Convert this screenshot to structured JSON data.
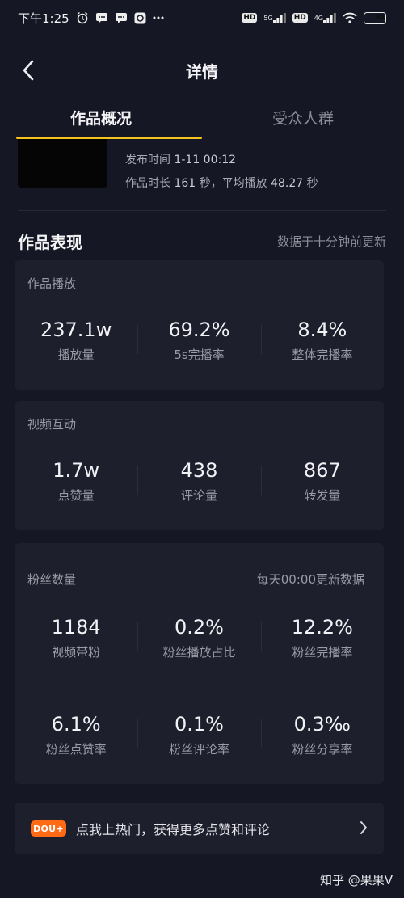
{
  "status_bar": {
    "time": "下午1:25",
    "left_icons": [
      "alarm-icon",
      "message-icon",
      "message-icon",
      "app-icon",
      "more-icon"
    ],
    "hd1": "HD",
    "net1": "5G",
    "hd2": "HD",
    "net2": "4G",
    "battery": "84"
  },
  "header": {
    "title": "详情"
  },
  "tabs": [
    {
      "label": "作品概况",
      "active": true
    },
    {
      "label": "受众人群",
      "active": false
    }
  ],
  "video": {
    "publish_label": "发布时间",
    "publish_time": "1-11 00:12",
    "duration_prefix": "作品时长",
    "duration_value": "161",
    "duration_unit": "秒，平均播放",
    "avg_value": "48.27",
    "avg_unit": "秒"
  },
  "performance": {
    "title": "作品表现",
    "note": "数据于十分钟前更新"
  },
  "playback": {
    "label": "作品播放",
    "metrics": [
      {
        "value": "237.1w",
        "label": "播放量"
      },
      {
        "value": "69.2%",
        "label": "5s完播率"
      },
      {
        "value": "8.4%",
        "label": "整体完播率"
      }
    ]
  },
  "interaction": {
    "label": "视频互动",
    "metrics": [
      {
        "value": "1.7w",
        "label": "点赞量"
      },
      {
        "value": "438",
        "label": "评论量"
      },
      {
        "value": "867",
        "label": "转发量"
      }
    ]
  },
  "fans": {
    "label": "粉丝数量",
    "note": "每天00:00更新数据",
    "row1": [
      {
        "value": "1184",
        "label": "视频带粉"
      },
      {
        "value": "0.2%",
        "label": "粉丝播放占比"
      },
      {
        "value": "12.2%",
        "label": "粉丝完播率"
      }
    ],
    "row2": [
      {
        "value": "6.1%",
        "label": "粉丝点赞率"
      },
      {
        "value": "0.1%",
        "label": "粉丝评论率"
      },
      {
        "value": "0.3‰",
        "label": "粉丝分享率"
      }
    ]
  },
  "promo": {
    "badge": "DOU+",
    "text": "点我上热门，获得更多点赞和评论"
  },
  "watermark": "知乎 @果果V",
  "colors": {
    "background": "#161724",
    "card": "#1e1f2d",
    "accent": "#f6c21c",
    "badge": "#ff6a14"
  }
}
